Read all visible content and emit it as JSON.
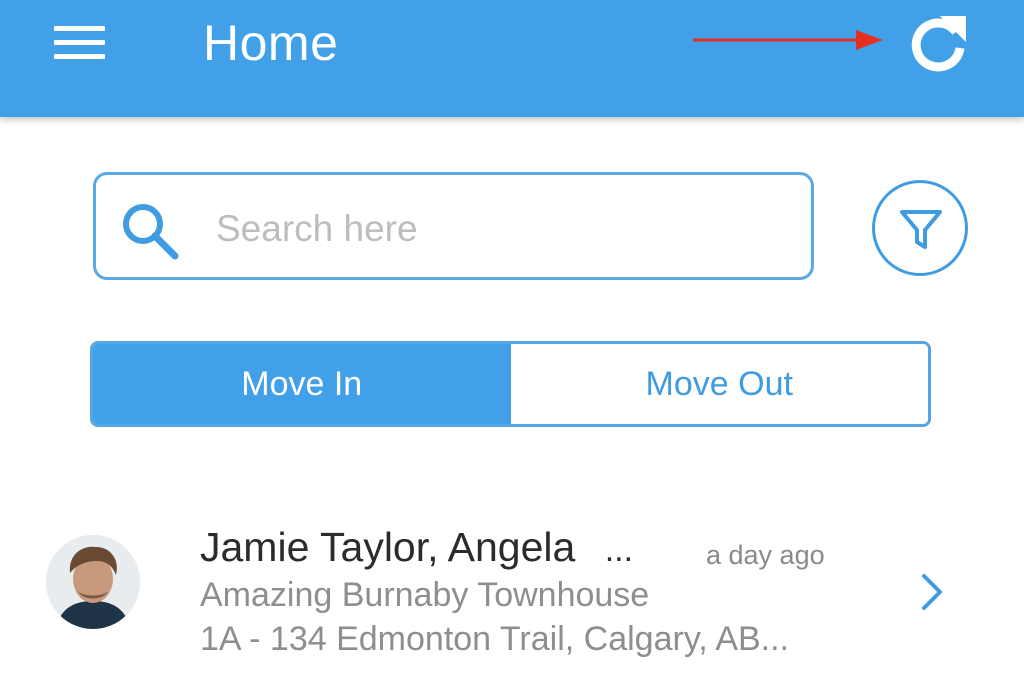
{
  "header": {
    "title": "Home",
    "menu_icon": "hamburger-menu-icon",
    "refresh_icon": "refresh-icon",
    "annotation": "red-arrow-pointing-to-refresh",
    "annotation_color": "#e53020",
    "bar_color": "#42a0e8"
  },
  "search": {
    "placeholder": "Search here",
    "value": "",
    "icon": "search-icon",
    "filter_icon": "filter-funnel-icon"
  },
  "tabs": [
    {
      "label": "Move In",
      "active": true
    },
    {
      "label": "Move Out",
      "active": false
    }
  ],
  "list": {
    "items": [
      {
        "name": "Jamie Taylor, Angela",
        "name_ellipsis": "...",
        "time": "a day ago",
        "property": "Amazing Burnaby Townhouse",
        "address": "1A - 134 Edmonton Trail, Calgary, AB...",
        "avatar_icon": "user-avatar",
        "chevron_icon": "chevron-right-icon"
      }
    ]
  },
  "colors": {
    "accent": "#42a0e8",
    "text_primary": "#2b2b2b",
    "text_secondary": "#8e8e8e"
  }
}
